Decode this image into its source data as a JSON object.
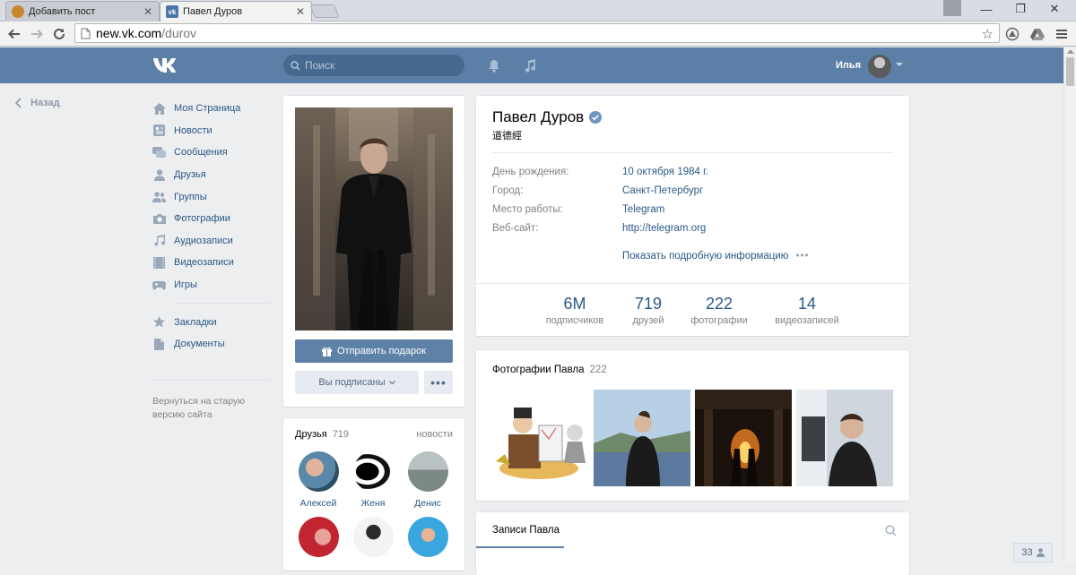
{
  "browser": {
    "tabs": [
      {
        "label": "Добавить пост",
        "active": false
      },
      {
        "label": "Павел Дуров",
        "active": true
      }
    ],
    "url_host": "new.vk.com",
    "url_path": "/durov"
  },
  "header": {
    "search_placeholder": "Поиск",
    "user_name": "Илья",
    "brand_color": "#5b7fa6"
  },
  "leftnav": {
    "back_label": "Назад",
    "items": [
      {
        "label": "Моя Страница",
        "icon": "home-icon"
      },
      {
        "label": "Новости",
        "icon": "news-icon"
      },
      {
        "label": "Сообщения",
        "icon": "messages-icon"
      },
      {
        "label": "Друзья",
        "icon": "friends-icon"
      },
      {
        "label": "Группы",
        "icon": "groups-icon"
      },
      {
        "label": "Фотографии",
        "icon": "camera-icon"
      },
      {
        "label": "Аудиозаписи",
        "icon": "music-icon"
      },
      {
        "label": "Видеозаписи",
        "icon": "video-icon"
      },
      {
        "label": "Игры",
        "icon": "gamepad-icon"
      }
    ],
    "items2": [
      {
        "label": "Закладки",
        "icon": "star-icon"
      },
      {
        "label": "Документы",
        "icon": "document-icon"
      }
    ],
    "old_version": "Вернуться на старую версию сайта"
  },
  "profile": {
    "gift_button": "Отправить подарок",
    "subscribed_button": "Вы подписаны",
    "more_button": "•••",
    "name": "Павел Дуров",
    "status": "道德經",
    "info": [
      {
        "label": "День рождения:",
        "value": "10 октября 1984 г."
      },
      {
        "label": "Город:",
        "value": "Санкт-Петербург"
      },
      {
        "label": "Место работы:",
        "value": "Telegram"
      },
      {
        "label": "Веб-сайт:",
        "value": "http://telegram.org"
      }
    ],
    "more_info": "Показать подробную информацию",
    "counters": [
      {
        "value": "6M",
        "label": "подписчиков"
      },
      {
        "value": "719",
        "label": "друзей"
      },
      {
        "value": "222",
        "label": "фотографии"
      },
      {
        "value": "14",
        "label": "видеозаписей"
      }
    ]
  },
  "friends": {
    "title": "Друзья",
    "count": "719",
    "link": "новости",
    "list": [
      "Алексей",
      "Женя",
      "Денис"
    ]
  },
  "photos": {
    "title": "Фотографии Павла",
    "count": "222"
  },
  "posts": {
    "tab_label": "Записи Павла"
  },
  "chat": {
    "count": "33"
  }
}
